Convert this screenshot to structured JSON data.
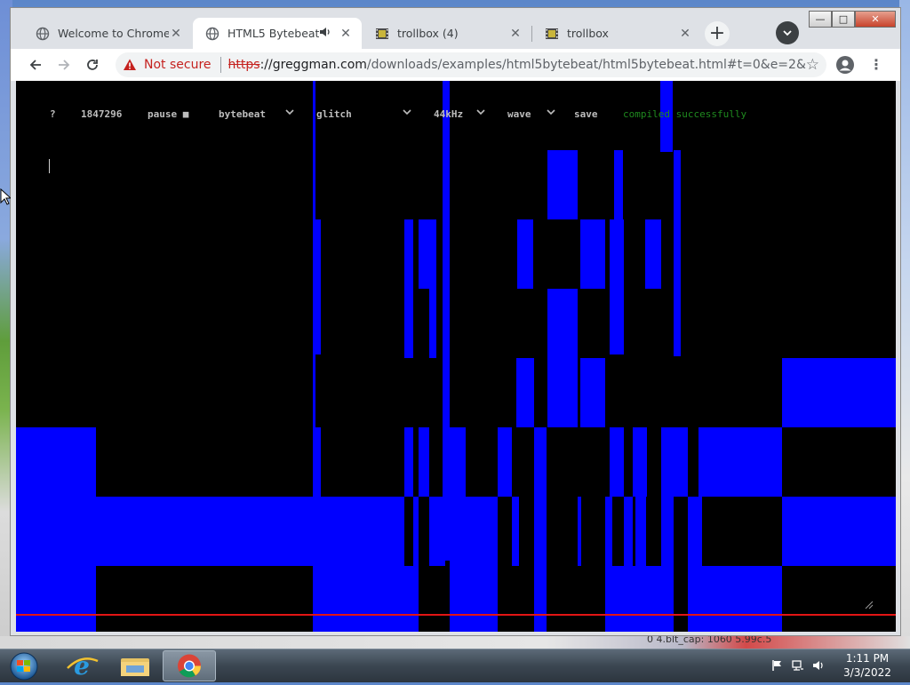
{
  "browser": {
    "tabs": [
      {
        "title": "Welcome to Chrome",
        "favicon": "globe-icon",
        "active": false
      },
      {
        "title": "HTML5 Bytebeat",
        "favicon": "globe-icon",
        "active": true,
        "audio": true
      },
      {
        "title": "trollbox (4)",
        "favicon": "film-icon",
        "active": false
      },
      {
        "title": "trollbox",
        "favicon": "film-icon",
        "active": false
      }
    ],
    "new_tab": "+",
    "window_controls": {
      "minimize": "—",
      "maximize": "□",
      "close": "✕"
    }
  },
  "toolbar": {
    "security_label": "Not secure",
    "url_scheme": "https",
    "url_host": "://greggman.com",
    "url_path": "/downloads/examples/html5bytebeat/html5bytebeat.html#t=0&e=2&s=44100&..."
  },
  "bytebeat": {
    "help": "?",
    "time": "1847296",
    "pause": "pause ■",
    "type": "bytebeat",
    "expression_type": "glitch",
    "sample_rate": "44kHz",
    "view": "wave",
    "save": "save",
    "status": "compiled successfully",
    "colors": {
      "wave": "#0000ff",
      "marker": "#e21414",
      "status": "#1f8a1f"
    }
  },
  "taskbar": {
    "time": "1:11 PM",
    "date": "3/3/2022",
    "items": [
      "internet-explorer-icon",
      "file-explorer-icon",
      "chrome-icon"
    ]
  },
  "desktop": {
    "partial_text": "0 4.blt_cap: 1060      5.99c.5"
  }
}
